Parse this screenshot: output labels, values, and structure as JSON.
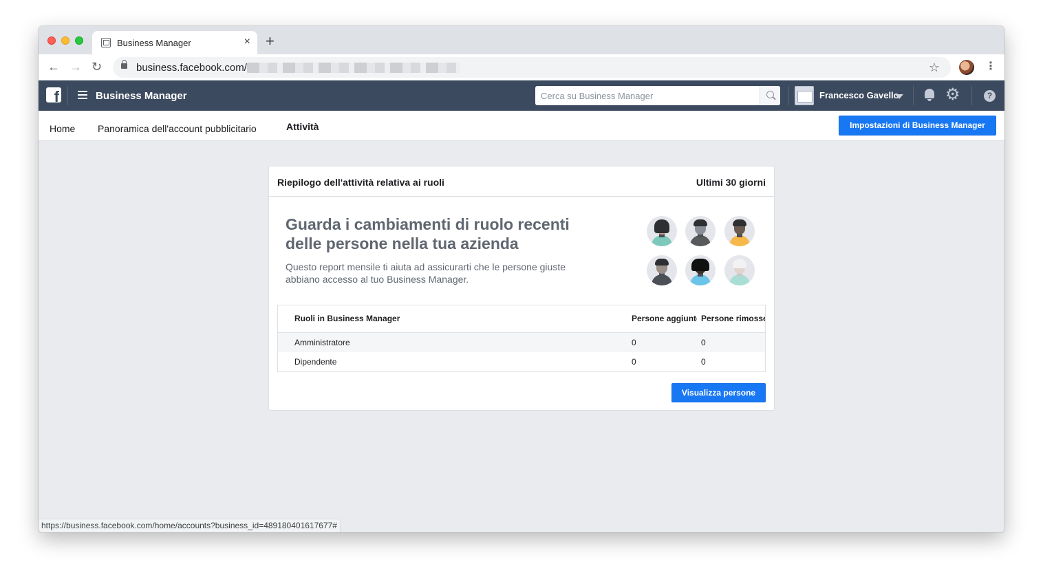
{
  "browser": {
    "tab_title": "Business Manager",
    "tab_close": "×",
    "new_tab": "+",
    "url": "business.facebook.com/",
    "status_url": "https://business.facebook.com/home/accounts?business_id=489180401617677#",
    "nav": {
      "back": "←",
      "forward": "→",
      "reload": "↻",
      "star": "☆",
      "menu": "⋮"
    }
  },
  "topbar": {
    "app_title": "Business Manager",
    "search_placeholder": "Cerca su Business Manager",
    "user_name": "Francesco Gavello",
    "help": "?",
    "bg_color": "#3b4a5e"
  },
  "subnav": {
    "items": [
      "Home",
      "Panoramica dell'account pubblicitario",
      "Attività"
    ],
    "active": "Attività",
    "settings_button": "Impostazioni di Business Manager"
  },
  "card": {
    "title": "Riepilogo dell'attività relativa ai ruoli",
    "period": "Ultimi 30 giorni",
    "headline": "Guarda i cambiamenti di ruolo recenti delle persone nella tua azienda",
    "subtext": "Questo report mensile ti aiuta ad assicurarti che le persone giuste abbiano accesso al tuo Business Manager.",
    "table": {
      "headers": [
        "Ruoli in Business Manager",
        "Persone aggiunte",
        "Persone rimosse"
      ],
      "rows": [
        [
          "Amministratore",
          "0",
          "0"
        ],
        [
          "Dipendente",
          "0",
          "0"
        ]
      ]
    },
    "view_button": "Visualizza persone"
  },
  "colors": {
    "accent": "#1877f2",
    "page_bg": "#e9ebee",
    "avatar_bodies": [
      "#7cc9bc",
      "#58595b",
      "#f7b84b",
      "#4b4f56",
      "#6bc5e8",
      "#a8ded3"
    ]
  }
}
